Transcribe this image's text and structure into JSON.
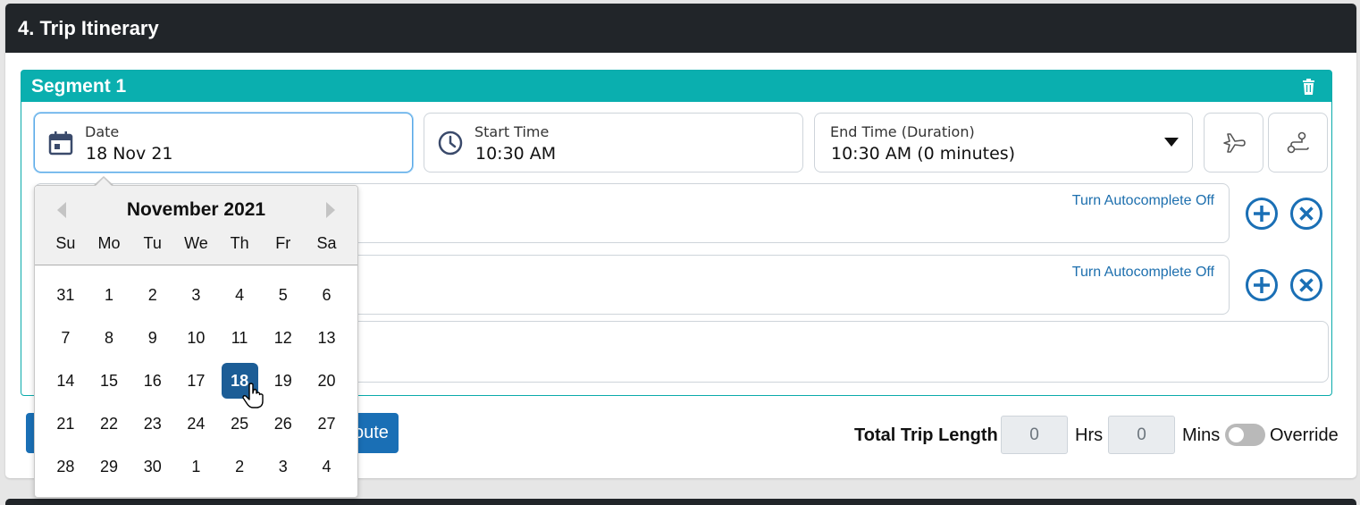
{
  "section": {
    "title": "4. Trip Itinerary"
  },
  "segment": {
    "title": "Segment 1"
  },
  "date_field": {
    "label": "Date",
    "value": "18 Nov 21"
  },
  "start_time": {
    "label": "Start Time",
    "value": "10:30 AM"
  },
  "end_time": {
    "label": "End Time (Duration)",
    "value": "10:30 AM (0 minutes)"
  },
  "locations": [
    {
      "autocomplete_label": "Turn Autocomplete Off"
    },
    {
      "autocomplete_label": "Turn Autocomplete Off"
    }
  ],
  "route_button": {
    "label": "oute"
  },
  "trip_length": {
    "label": "Total Trip Length",
    "hours": "0",
    "hours_unit": "Hrs",
    "minutes": "0",
    "minutes_unit": "Mins",
    "override_label": "Override"
  },
  "datepicker": {
    "month_title": "November 2021",
    "weekdays": [
      "Su",
      "Mo",
      "Tu",
      "We",
      "Th",
      "Fr",
      "Sa"
    ],
    "weeks": [
      [
        "31",
        "1",
        "2",
        "3",
        "4",
        "5",
        "6"
      ],
      [
        "7",
        "8",
        "9",
        "10",
        "11",
        "12",
        "13"
      ],
      [
        "14",
        "15",
        "16",
        "17",
        "18",
        "19",
        "20"
      ],
      [
        "21",
        "22",
        "23",
        "24",
        "25",
        "26",
        "27"
      ],
      [
        "28",
        "29",
        "30",
        "1",
        "2",
        "3",
        "4"
      ]
    ],
    "selected_day": "18"
  },
  "colors": {
    "header_bg": "#212529",
    "segment_accent": "#0aafaf",
    "primary": "#1a6fb5",
    "selected_day": "#1c5d96"
  }
}
